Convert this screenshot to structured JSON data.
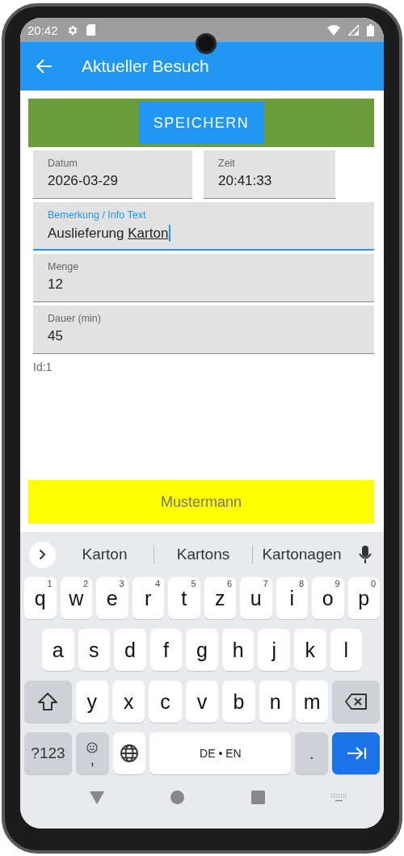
{
  "status_bar": {
    "time": "20:42"
  },
  "app_bar": {
    "title": "Aktueller Besuch"
  },
  "save_button": "SPEICHERN",
  "field_rows": [
    [
      {
        "label": "Datum",
        "value": "2026-03-29",
        "focused": false
      },
      {
        "label": "Zeit",
        "value": "20:41:33",
        "focused": false
      }
    ],
    [
      {
        "label": "Bemerkung / Info Text",
        "value": "Auslieferung",
        "composing": "Karton",
        "focused": true
      }
    ],
    [
      {
        "label": "Menge",
        "value": "12",
        "focused": false
      }
    ],
    [
      {
        "label": "Dauer (min)",
        "value": "45",
        "focused": false
      }
    ]
  ],
  "id_text": "Id:1",
  "customer_bar": "Mustermann",
  "keyboard": {
    "suggestions": [
      "Karton",
      "Kartons",
      "Kartonagen"
    ],
    "rows": [
      [
        {
          "kind": "letter",
          "label": "q",
          "hint": "1"
        },
        {
          "kind": "letter",
          "label": "w",
          "hint": "2"
        },
        {
          "kind": "letter",
          "label": "e",
          "hint": "3"
        },
        {
          "kind": "letter",
          "label": "r",
          "hint": "4"
        },
        {
          "kind": "letter",
          "label": "t",
          "hint": "5"
        },
        {
          "kind": "letter",
          "label": "z",
          "hint": "6"
        },
        {
          "kind": "letter",
          "label": "u",
          "hint": "7"
        },
        {
          "kind": "letter",
          "label": "i",
          "hint": "8"
        },
        {
          "kind": "letter",
          "label": "o",
          "hint": "9"
        },
        {
          "kind": "letter",
          "label": "p",
          "hint": "0"
        }
      ],
      [
        {
          "kind": "letter",
          "label": "a"
        },
        {
          "kind": "letter",
          "label": "s"
        },
        {
          "kind": "letter",
          "label": "d"
        },
        {
          "kind": "letter",
          "label": "f"
        },
        {
          "kind": "letter",
          "label": "g"
        },
        {
          "kind": "letter",
          "label": "h"
        },
        {
          "kind": "letter",
          "label": "j"
        },
        {
          "kind": "letter",
          "label": "k"
        },
        {
          "kind": "letter",
          "label": "l"
        }
      ],
      [
        {
          "kind": "shift"
        },
        {
          "kind": "letter",
          "label": "y"
        },
        {
          "kind": "letter",
          "label": "x"
        },
        {
          "kind": "letter",
          "label": "c"
        },
        {
          "kind": "letter",
          "label": "v"
        },
        {
          "kind": "letter",
          "label": "b"
        },
        {
          "kind": "letter",
          "label": "n"
        },
        {
          "kind": "letter",
          "label": "m"
        },
        {
          "kind": "backspace"
        }
      ]
    ],
    "bottom_row": [
      {
        "kind": "symbols",
        "label": "?123"
      },
      {
        "kind": "emoji",
        "label": ","
      },
      {
        "kind": "globe"
      },
      {
        "kind": "space",
        "label": "DE • EN"
      },
      {
        "kind": "period",
        "label": "."
      },
      {
        "kind": "enter"
      }
    ]
  }
}
